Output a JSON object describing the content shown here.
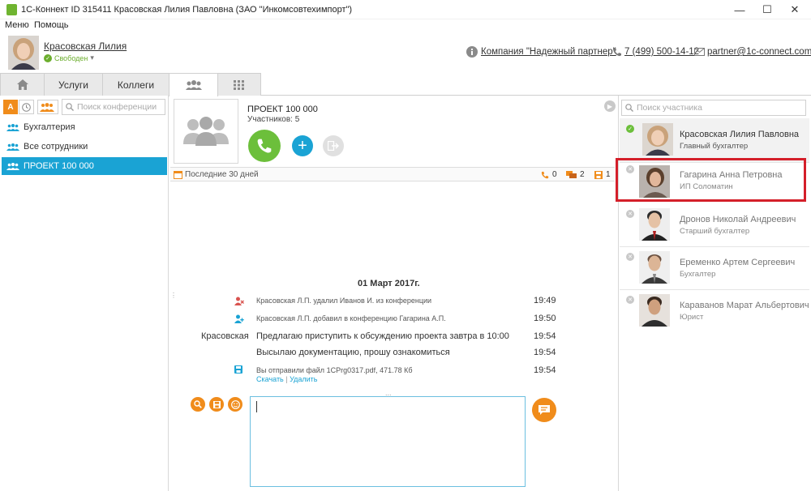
{
  "window": {
    "title": "1С-Коннект ID 315411 Красовская Лилия Павловна (ЗАО \"Инкомсовтехимпорт\")",
    "minimize": "—",
    "maximize": "☐",
    "close": "✕"
  },
  "menu": {
    "items": [
      "Меню",
      "Помощь"
    ]
  },
  "user": {
    "name": "Красовская Лилия",
    "status": "Свободен"
  },
  "header": {
    "company": "Компания \"Надежный партнер\"",
    "phone": "7 (499) 500-14-12",
    "email": "partner@1c-connect.com"
  },
  "tabs": [
    {
      "label": "",
      "icon": "home-icon"
    },
    {
      "label": "Услуги"
    },
    {
      "label": "Коллеги"
    },
    {
      "label": "",
      "icon": "group-icon"
    },
    {
      "label": "",
      "icon": "grid-icon"
    }
  ],
  "left": {
    "filter_alpha": "А",
    "search_placeholder": "Поиск конференции",
    "conferences": [
      "Бухгалтерия",
      "Все сотрудники",
      "ПРОЕКТ 100 000"
    ]
  },
  "conference": {
    "title": "ПРОЕКТ 100 000",
    "participants": "Участников: 5",
    "period": "Последние 30 дней",
    "calls": "0",
    "messages": "2",
    "files": "1"
  },
  "chat": {
    "date": "01 Март 2017г.",
    "events": [
      {
        "text": "Красовская Л.П. удалил Иванов И. из конференции",
        "time": "19:49"
      },
      {
        "text": "Красовская Л.П. добавил в конференцию Гагарина А.П.",
        "time": "19:50"
      }
    ],
    "sender": "Красовская",
    "messages": [
      {
        "text": "Предлагаю приступить к обсуждению проекта завтра в 10:00",
        "time": "19:54"
      },
      {
        "text": "Высылаю документацию, прошу ознакомиться",
        "time": "19:54"
      }
    ],
    "file": {
      "text": "Вы отправили файл 1CPrg0317.pdf, 471.78 Кб",
      "time": "19:54",
      "download": "Скачать",
      "separator": "|",
      "delete": "Удалить"
    },
    "splitter": "..."
  },
  "right": {
    "search_placeholder": "Поиск участника",
    "participants": [
      {
        "name": "Красовская Лилия Павловна",
        "role": "Главный бухгалтер",
        "online": true
      },
      {
        "name": "Гагарина Анна Петровна",
        "role": "ИП Соломатин",
        "online": false
      },
      {
        "name": "Дронов Николай Андреевич",
        "role": "Старший бухгалтер",
        "online": false
      },
      {
        "name": "Еременко Артем Сергеевич",
        "role": "Бухгалтер",
        "online": false
      },
      {
        "name": "Караванов Марат Альбертович",
        "role": "Юрист",
        "online": false
      }
    ]
  },
  "colors": {
    "accent": "#1aa3d4",
    "green": "#6cbf3b",
    "orange": "#f08c1b",
    "highlight": "#d41f2a"
  }
}
